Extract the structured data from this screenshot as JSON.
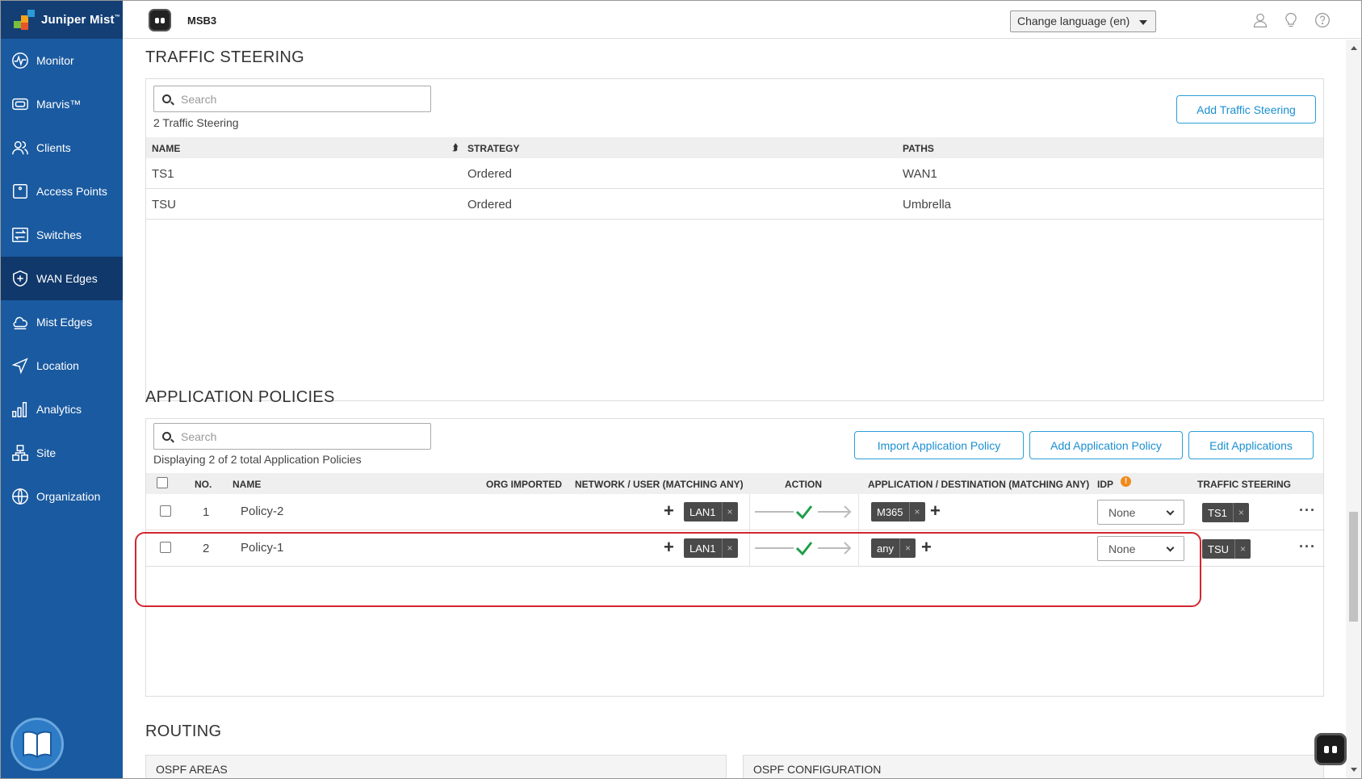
{
  "brand": {
    "name": "Juniper Mist",
    "trademark": "™"
  },
  "sidebar": {
    "items": [
      {
        "label": "Monitor",
        "icon": "monitor-icon"
      },
      {
        "label": "Marvis™",
        "icon": "marvis-icon"
      },
      {
        "label": "Clients",
        "icon": "clients-icon"
      },
      {
        "label": "Access Points",
        "icon": "access-points-icon"
      },
      {
        "label": "Switches",
        "icon": "switches-icon"
      },
      {
        "label": "WAN Edges",
        "icon": "wan-edges-icon",
        "active": true
      },
      {
        "label": "Mist Edges",
        "icon": "mist-edges-icon"
      },
      {
        "label": "Location",
        "icon": "location-icon"
      },
      {
        "label": "Analytics",
        "icon": "analytics-icon"
      },
      {
        "label": "Site",
        "icon": "site-icon"
      },
      {
        "label": "Organization",
        "icon": "organization-icon"
      }
    ]
  },
  "header": {
    "site": "MSB3",
    "language": "Change language (en)"
  },
  "traffic_steering": {
    "title": "TRAFFIC STEERING",
    "search_placeholder": "Search",
    "count": "2 Traffic Steering",
    "add_button": "Add Traffic Steering",
    "columns": {
      "name": "NAME",
      "strategy": "STRATEGY",
      "paths": "PATHS"
    },
    "rows": [
      {
        "name": "TS1",
        "strategy": "Ordered",
        "paths": "WAN1"
      },
      {
        "name": "TSU",
        "strategy": "Ordered",
        "paths": "Umbrella"
      }
    ]
  },
  "application_policies": {
    "title": "APPLICATION POLICIES",
    "search_placeholder": "Search",
    "count": "Displaying 2 of 2 total Application Policies",
    "buttons": {
      "import": "Import Application Policy",
      "add": "Add Application Policy",
      "edit": "Edit Applications"
    },
    "columns": {
      "no": "NO.",
      "name": "NAME",
      "org_imported": "ORG IMPORTED",
      "network": "NETWORK / USER (MATCHING ANY)",
      "action": "ACTION",
      "application": "APPLICATION / DESTINATION (MATCHING ANY)",
      "idp": "IDP",
      "traffic_steering": "TRAFFIC STEERING"
    },
    "rows": [
      {
        "no": "1",
        "name": "Policy-2",
        "network": "LAN1",
        "application": "M365",
        "idp": "None",
        "steering": "TS1"
      },
      {
        "no": "2",
        "name": "Policy-1",
        "network": "LAN1",
        "application": "any",
        "idp": "None",
        "steering": "TSU"
      }
    ],
    "tag_close": "×",
    "plus": "+",
    "more": "···"
  },
  "routing": {
    "title": "ROUTING",
    "ospf_areas": "OSPF AREAS",
    "ospf_config": "OSPF CONFIGURATION"
  },
  "colors": {
    "sidebar": "#1a5aa0",
    "sidebar_active": "#10386b",
    "accent": "#1b8fd0",
    "highlight": "#d2262f",
    "action_check": "#1f9e4a"
  }
}
